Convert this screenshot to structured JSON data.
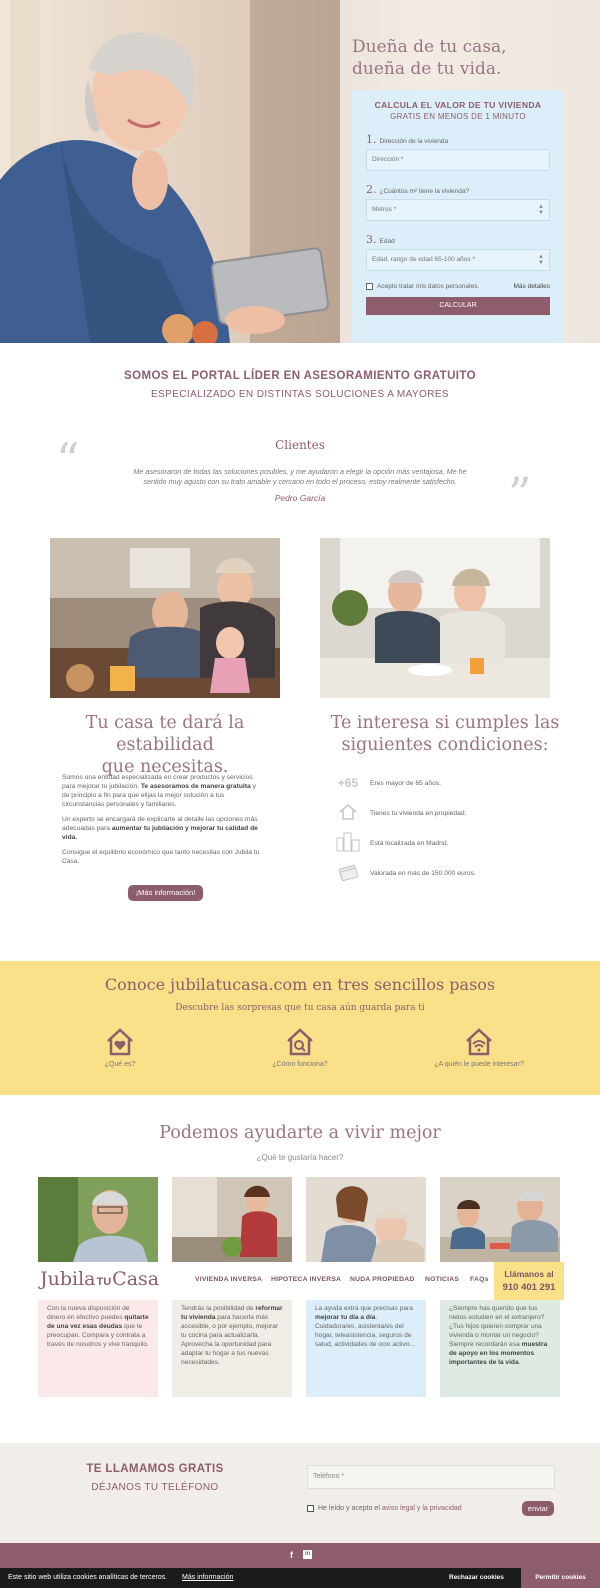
{
  "hero": {
    "headline_line1": "Dueña de tu casa,",
    "headline_line2": "dueña de tu vida.",
    "calc_title": "CALCULA EL VALOR DE TU VIVIENDA",
    "calc_subtitle": "GRATIS EN MENOS DE 1 MINUTO",
    "fields": [
      {
        "num": "1.",
        "label": "Dirección de la vivienda",
        "placeholder": "Dirección *"
      },
      {
        "num": "2.",
        "label": "¿Cuántos m² tiene la vivienda?",
        "placeholder": "Metros *"
      },
      {
        "num": "3.",
        "label": "Edad",
        "placeholder": "Edad, rango de edad 65-100 años *"
      }
    ],
    "consent": "Acepto tratar mis datos personales.",
    "more_details": "Más detalles",
    "calc_button": "CALCULAR"
  },
  "intro": {
    "title": "SOMOS EL PORTAL LÍDER EN ASESORAMIENTO GRATUITO",
    "subtitle": "ESPECIALIZADO EN DISTINTAS SOLUCIONES A MAYORES"
  },
  "testimonial": {
    "heading": "Clientes",
    "text_line1": "Me asesoraron de todas las soluciones posibles, y me ayudaron a elegir la opción más ventajosa. Me he",
    "text_line2": "sentido muy agusto con su trato amable y cercano en todo el proceso, estoy realmente satisfecho.",
    "author": "Pedro García"
  },
  "stability": {
    "title_line1": "Tu casa te dará la estabilidad",
    "title_line2": "que necesitas.",
    "p1_a": "Somos una entidad especializada en crear productos y servicios para mejorar tu jubilación. ",
    "p1_b": "Te asesoramos de manera gratuita",
    "p1_c": " y de principio a fin para que elijas la mejor solución a tus circunstancias personales y familiares.",
    "p2_a": "Un experto se encargará de explicarte al detalle las opciones más adecuadas para ",
    "p2_b": "aumentar tu jubilación y mejorar tu calidad de vida.",
    "p3": "Consigue el equilibrio económico que tanto necesitas con Jubila tu Casa.",
    "more_button": "¡Más información!"
  },
  "conditions": {
    "title_line1": "Te interesa si cumples las",
    "title_line2": "siguientes condiciones:",
    "items": [
      {
        "icon": "+65",
        "text": "Eres mayor de 65 años."
      },
      {
        "icon": "house-icon",
        "text": "Tienes tu vivienda en propiedad."
      },
      {
        "icon": "buildings-icon",
        "text": "Está localizada en Madrid."
      },
      {
        "icon": "money-icon",
        "text": "Valorada en más de 150.000 euros."
      }
    ]
  },
  "steps": {
    "title": "Conoce jubilatucasa.com en tres sencillos pasos",
    "subtitle": "Descubre las sorpresas que tu casa aún guarda para ti",
    "items": [
      {
        "label": "¿Qué es?",
        "icon": "heart-house-icon"
      },
      {
        "label": "¿Cómo funciona?",
        "icon": "search-house-icon"
      },
      {
        "label": "¿A quién le puede interesar?",
        "icon": "wifi-house-icon"
      }
    ]
  },
  "help": {
    "title": "Podemos ayudarte a vivir mejor",
    "subtitle": "¿Qué te gustaría hacer?",
    "cards": [
      {
        "color": "#fbe9ea",
        "t1": "Con la nueva disposición de dinero en efectivo puedes ",
        "b1": "quitarte de una vez esas deudas",
        "t2": " que te preocupan. Compara y contrata a través de nosotros y vive tranquilo."
      },
      {
        "color": "#f0ece6",
        "t1": "Tendrás la posibilidad de ",
        "b1": "reformar tu vivienda",
        "t2": " para hacerla más accesible, o por ejemplo, mejorar tu cocina para actualizarla. Aprovecha la oportunidad para adaptar tu hogar a tus nuevas necesidades."
      },
      {
        "color": "#dbeef9",
        "t1": "La ayuda extra que precisas para ",
        "b1": "mejorar tu día a día",
        "t2": ". Cuidadora/es, asistenta/es del hogar, teleasistencia, seguros de salud, actividades de ocio activo..."
      },
      {
        "color": "#dfeae3",
        "t1": "¿Siempre has querido que tus nietos estudien en el extranjero? ¿Tus hijos quieren comprar una vivienda o montar un negocio? Siempre recordarán esa ",
        "b1": "muestra de apoyo en los momentos importantes de la vida",
        "t2": "."
      }
    ]
  },
  "nav": {
    "logo_a": "Jubila",
    "logo_b": "TU",
    "logo_c": "Casa",
    "items": [
      "VIVIENDA INVERSA",
      "HIPOTECA INVERSA",
      "NUDA PROPIEDAD",
      "NOTICIAS",
      "FAQs"
    ],
    "call_label": "Llámanos al",
    "call_number": "910 401 291"
  },
  "callback": {
    "title": "TE LLAMAMOS GRATIS",
    "subtitle": "DÉJANOS TU TELÉFONO",
    "phone_placeholder": "Teléfono *",
    "consent_a": "He leído y acepto el ",
    "consent_link": "aviso legal y la privacidad",
    "send": "enviar"
  },
  "footer": {
    "facebook": "f",
    "linkedin": "in"
  },
  "cookies": {
    "text": "Este sitio web utiliza cookies analíticas de terceros.",
    "link": "Más información",
    "reject": "Rechazar cookies",
    "accept": "Permitir cookies"
  },
  "colors": {
    "brand": "#8e5d6b",
    "yellow": "#fbe08a",
    "light_blue": "#dbeef9"
  }
}
